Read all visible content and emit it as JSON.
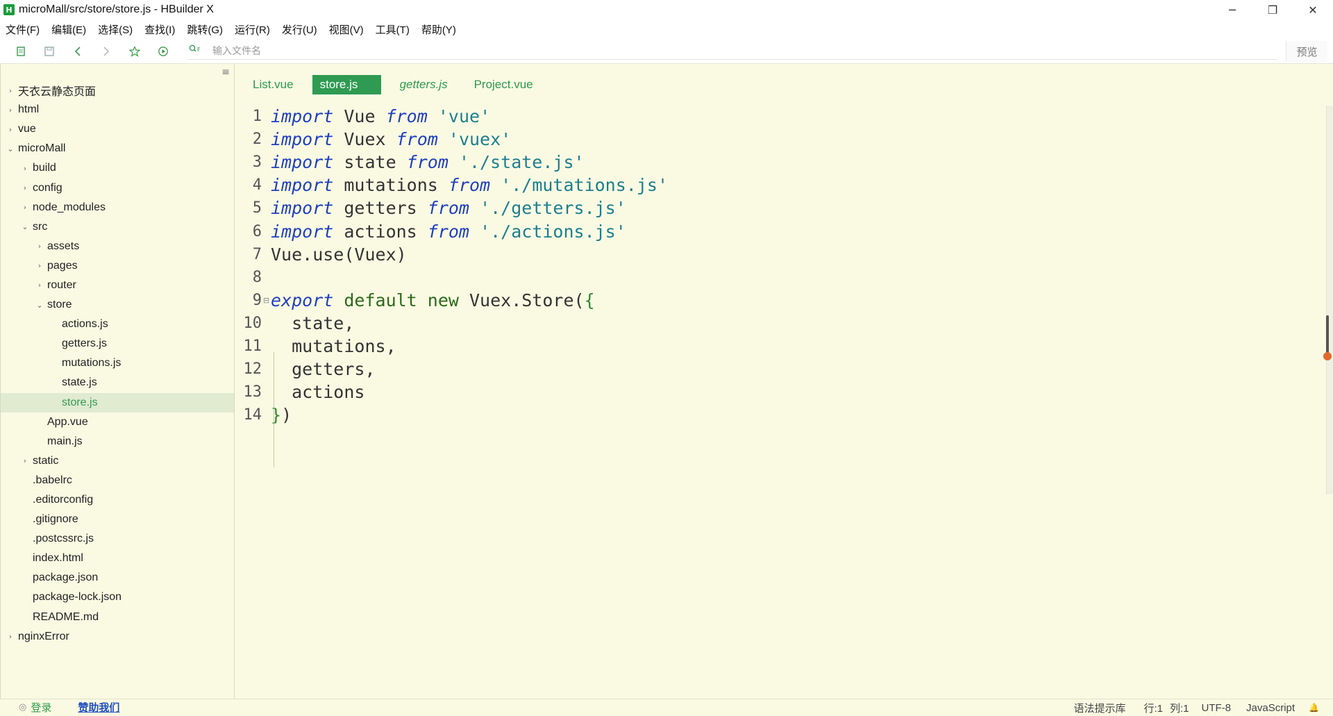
{
  "window": {
    "app_logo": "H",
    "title": "microMall/src/store/store.js - HBuilder X",
    "minimize": "─",
    "restore": "❐",
    "close": "✕"
  },
  "menu": [
    "文件(F)",
    "编辑(E)",
    "选择(S)",
    "查找(I)",
    "跳转(G)",
    "运行(R)",
    "发行(U)",
    "视图(V)",
    "工具(T)",
    "帮助(Y)"
  ],
  "toolbar": {
    "icons": [
      "new-file-icon",
      "save-icon",
      "back-icon",
      "forward-icon",
      "star-icon",
      "run-icon"
    ],
    "search_placeholder": "输入文件名",
    "preview_label": "预览"
  },
  "sidebar": {
    "menu_icon": "≡",
    "tree": [
      {
        "label": "天衣云静态页面",
        "depth": 0,
        "arrow": "›"
      },
      {
        "label": "html",
        "depth": 0,
        "arrow": "›"
      },
      {
        "label": "vue",
        "depth": 0,
        "arrow": "›"
      },
      {
        "label": "microMall",
        "depth": 0,
        "arrow": "⌄"
      },
      {
        "label": "build",
        "depth": 1,
        "arrow": "›"
      },
      {
        "label": "config",
        "depth": 1,
        "arrow": "›"
      },
      {
        "label": "node_modules",
        "depth": 1,
        "arrow": "›"
      },
      {
        "label": "src",
        "depth": 1,
        "arrow": "⌄"
      },
      {
        "label": "assets",
        "depth": 2,
        "arrow": "›"
      },
      {
        "label": "pages",
        "depth": 2,
        "arrow": "›"
      },
      {
        "label": "router",
        "depth": 2,
        "arrow": "›"
      },
      {
        "label": "store",
        "depth": 2,
        "arrow": "⌄"
      },
      {
        "label": "actions.js",
        "depth": 3,
        "arrow": ""
      },
      {
        "label": "getters.js",
        "depth": 3,
        "arrow": ""
      },
      {
        "label": "mutations.js",
        "depth": 3,
        "arrow": ""
      },
      {
        "label": "state.js",
        "depth": 3,
        "arrow": ""
      },
      {
        "label": "store.js",
        "depth": 3,
        "arrow": "",
        "selected": true
      },
      {
        "label": "App.vue",
        "depth": 2,
        "arrow": ""
      },
      {
        "label": "main.js",
        "depth": 2,
        "arrow": ""
      },
      {
        "label": "static",
        "depth": 1,
        "arrow": "›"
      },
      {
        "label": ".babelrc",
        "depth": 1,
        "arrow": ""
      },
      {
        "label": ".editorconfig",
        "depth": 1,
        "arrow": ""
      },
      {
        "label": ".gitignore",
        "depth": 1,
        "arrow": ""
      },
      {
        "label": ".postcssrc.js",
        "depth": 1,
        "arrow": ""
      },
      {
        "label": "index.html",
        "depth": 1,
        "arrow": ""
      },
      {
        "label": "package.json",
        "depth": 1,
        "arrow": ""
      },
      {
        "label": "package-lock.json",
        "depth": 1,
        "arrow": ""
      },
      {
        "label": "README.md",
        "depth": 1,
        "arrow": ""
      },
      {
        "label": "nginxError",
        "depth": 0,
        "arrow": "›"
      }
    ]
  },
  "tabs": [
    {
      "label": "List.vue",
      "active": false,
      "italic": false
    },
    {
      "label": "store.js",
      "active": true,
      "italic": false
    },
    {
      "label": "getters.js",
      "active": false,
      "italic": true
    },
    {
      "label": "Project.vue",
      "active": false,
      "italic": false
    }
  ],
  "code": [
    {
      "n": "1",
      "tokens": [
        [
          "kw",
          "import"
        ],
        [
          "pn",
          " Vue "
        ],
        [
          "kw",
          "from"
        ],
        [
          "pn",
          " "
        ],
        [
          "str",
          "'vue'"
        ]
      ]
    },
    {
      "n": "2",
      "tokens": [
        [
          "kw",
          "import"
        ],
        [
          "pn",
          " Vuex "
        ],
        [
          "kw",
          "from"
        ],
        [
          "pn",
          " "
        ],
        [
          "str",
          "'vuex'"
        ]
      ]
    },
    {
      "n": "3",
      "tokens": [
        [
          "kw",
          "import"
        ],
        [
          "pn",
          " state "
        ],
        [
          "kw",
          "from"
        ],
        [
          "pn",
          " "
        ],
        [
          "str",
          "'./state.js'"
        ]
      ]
    },
    {
      "n": "4",
      "tokens": [
        [
          "kw",
          "import"
        ],
        [
          "pn",
          " mutations "
        ],
        [
          "kw",
          "from"
        ],
        [
          "pn",
          " "
        ],
        [
          "str",
          "'./mutations.js'"
        ]
      ]
    },
    {
      "n": "5",
      "tokens": [
        [
          "kw",
          "import"
        ],
        [
          "pn",
          " getters "
        ],
        [
          "kw",
          "from"
        ],
        [
          "pn",
          " "
        ],
        [
          "str",
          "'./getters.js'"
        ]
      ]
    },
    {
      "n": "6",
      "tokens": [
        [
          "kw",
          "import"
        ],
        [
          "pn",
          " actions "
        ],
        [
          "kw",
          "from"
        ],
        [
          "pn",
          " "
        ],
        [
          "str",
          "'./actions.js'"
        ]
      ]
    },
    {
      "n": "7",
      "tokens": [
        [
          "pn",
          "Vue.use(Vuex)"
        ]
      ]
    },
    {
      "n": "8",
      "tokens": []
    },
    {
      "n": "9",
      "fold": "⊟",
      "tokens": [
        [
          "kw",
          "export"
        ],
        [
          "pn",
          " "
        ],
        [
          "def",
          "default"
        ],
        [
          "pn",
          " "
        ],
        [
          "def",
          "new"
        ],
        [
          "pn",
          " Vuex.Store("
        ],
        [
          "brace",
          "{"
        ]
      ]
    },
    {
      "n": "10",
      "tokens": [
        [
          "pn",
          "  state,"
        ]
      ]
    },
    {
      "n": "11",
      "tokens": [
        [
          "pn",
          "  mutations,"
        ]
      ]
    },
    {
      "n": "12",
      "tokens": [
        [
          "pn",
          "  getters,"
        ]
      ]
    },
    {
      "n": "13",
      "tokens": [
        [
          "pn",
          "  actions"
        ]
      ]
    },
    {
      "n": "14",
      "tokens": [
        [
          "brace",
          "}"
        ],
        [
          "pn",
          ")"
        ]
      ]
    }
  ],
  "status": {
    "login_icon": "◎",
    "login": "登录",
    "sponsor": "赞助我们",
    "syntax": "语法提示库",
    "line": "行:1",
    "col": "列:1",
    "encoding": "UTF-8",
    "language": "JavaScript",
    "bell_icon": "🔔"
  },
  "colors": {
    "accent": "#2f9a52",
    "background": "#fafae3",
    "keyword": "#1f3fbf",
    "string": "#1b7f8f"
  }
}
